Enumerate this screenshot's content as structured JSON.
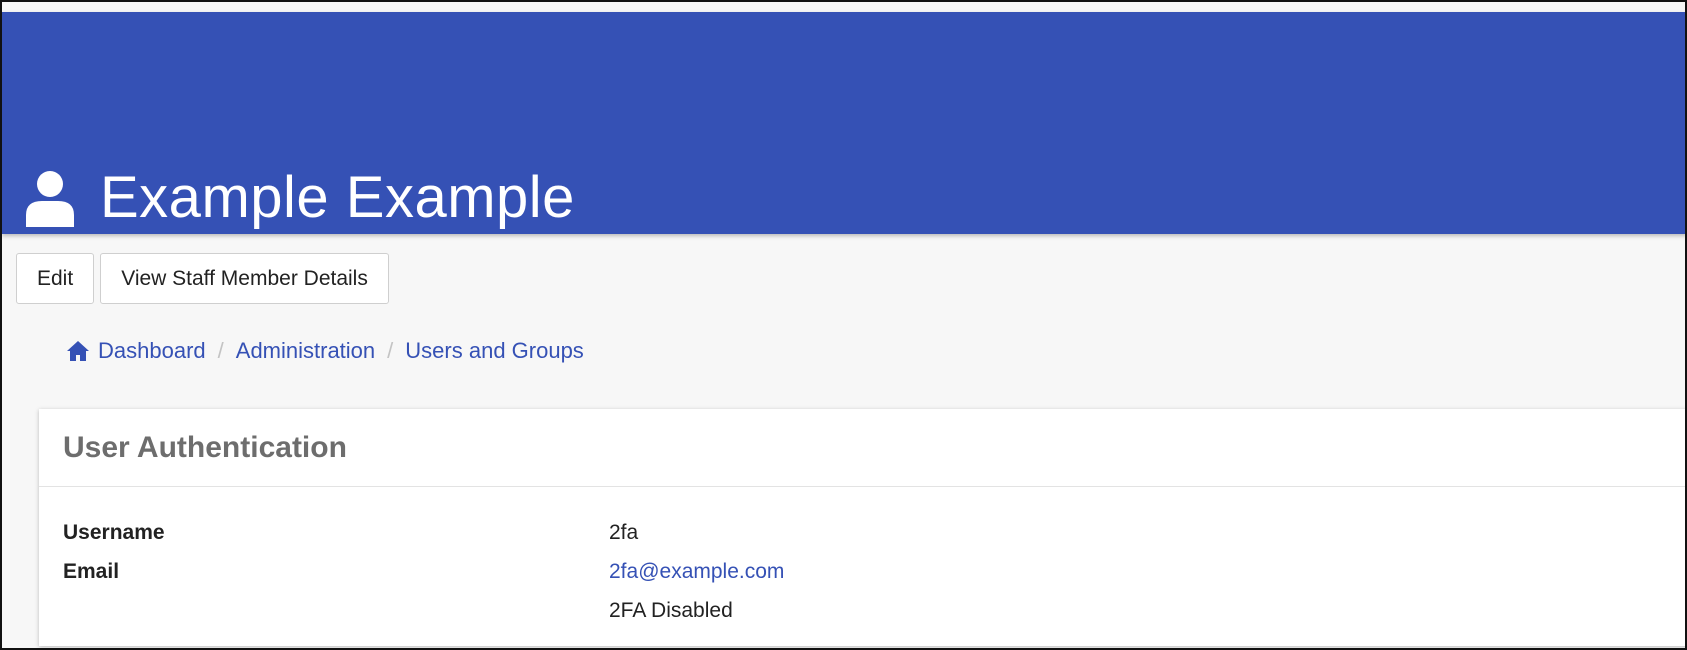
{
  "header": {
    "title": "Example Example",
    "icon": "user-icon",
    "background_color": "#3551b5"
  },
  "toolbar": {
    "edit_label": "Edit",
    "view_staff_label": "View Staff Member Details"
  },
  "breadcrumb": {
    "home_icon": "home-icon",
    "items": [
      "Dashboard",
      "Administration",
      "Users and Groups"
    ],
    "separator": "/"
  },
  "card": {
    "title": "User Authentication",
    "rows": [
      {
        "label": "Username",
        "value": "2fa"
      },
      {
        "label": "Email",
        "value": "2fa@example.com"
      },
      {
        "label": "",
        "value": "2FA Disabled"
      }
    ]
  }
}
